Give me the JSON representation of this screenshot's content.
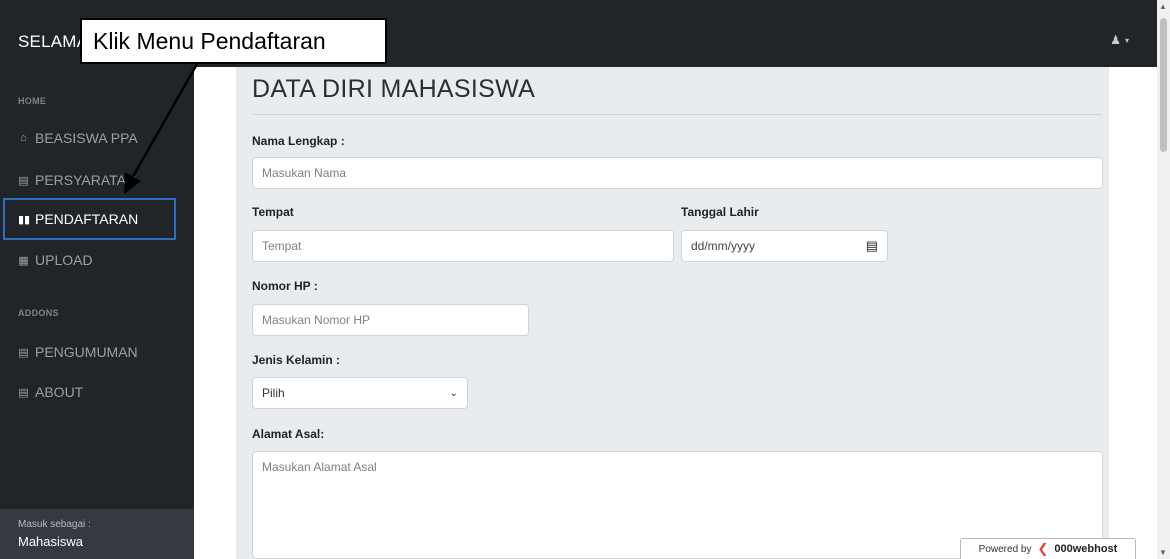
{
  "header": {
    "brand": "SELAMA",
    "user_icon": "user-icon",
    "caret_icon": "caret-down-icon"
  },
  "sidebar": {
    "sections": [
      "HOME",
      "ADDONS"
    ],
    "items": [
      {
        "label": "BEASISWA PPA",
        "icon": "home-icon"
      },
      {
        "label": "PERSYARATAN",
        "icon": "book-icon"
      },
      {
        "label": "PENDAFTARAN",
        "icon": "book-open-icon"
      },
      {
        "label": "UPLOAD",
        "icon": "file-icon"
      },
      {
        "label": "PENGUMUMAN",
        "icon": "book-icon"
      },
      {
        "label": "ABOUT",
        "icon": "book-icon"
      }
    ],
    "footer_label": "Masuk sebagai :",
    "footer_value": "Mahasiswa"
  },
  "form": {
    "title": "DATA DIRI MAHASISWA",
    "nama_label": "Nama Lengkap :",
    "nama_placeholder": "Masukan Nama",
    "tempat_label": "Tempat",
    "tempat_placeholder": "Tempat",
    "tanggal_label": "Tanggal Lahir",
    "tanggal_value": "dd/mm/yyyy",
    "hp_label": "Nomor HP :",
    "hp_placeholder": "Masukan Nomor HP",
    "jk_label": "Jenis Kelamin :",
    "jk_value": "Pilih",
    "alamat_label": "Alamat Asal:",
    "alamat_placeholder": "Masukan Alamat Asal"
  },
  "badge": {
    "prefix": "Powered by",
    "brand": "000webhost"
  },
  "annotation": {
    "callout": "Klik Menu Pendaftaran"
  },
  "colors": {
    "sidebar": "#212529",
    "active_border": "#2f6fbf",
    "card": "#e9ecef"
  }
}
